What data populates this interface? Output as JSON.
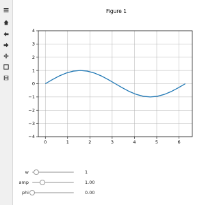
{
  "window": {
    "title": "Figure 1"
  },
  "toolbar": {
    "items": [
      {
        "name": "menu-icon"
      },
      {
        "name": "home-icon"
      },
      {
        "name": "back-arrow-icon"
      },
      {
        "name": "forward-arrow-icon"
      },
      {
        "name": "pan-move-icon"
      },
      {
        "name": "zoom-rect-icon"
      },
      {
        "name": "save-icon"
      }
    ]
  },
  "sliders": [
    {
      "label": "w",
      "value_text": "1",
      "value": 1,
      "min": 0,
      "max": 10
    },
    {
      "label": "amp",
      "value_text": "1.00",
      "value": 1,
      "min": 0,
      "max": 4
    },
    {
      "label": "phi",
      "value_text": "0.00",
      "value": 0,
      "min": 0,
      "max": 6.283
    }
  ],
  "colors": {
    "line": "#1f77b4",
    "grid": "#b0b0b0"
  },
  "chart_data": {
    "type": "line",
    "title": "",
    "xlabel": "",
    "ylabel": "",
    "xlim": [
      -0.314,
      6.597
    ],
    "ylim": [
      -4,
      4
    ],
    "xticks": [
      0,
      1,
      2,
      3,
      4,
      5,
      6
    ],
    "xtick_labels": [
      "0",
      "1",
      "2",
      "3",
      "4",
      "5",
      "6"
    ],
    "yticks": [
      -4,
      -3,
      -2,
      -1,
      0,
      1,
      2,
      3,
      4
    ],
    "ytick_labels": [
      "−4",
      "−3",
      "−2",
      "−1",
      "0",
      "1",
      "2",
      "3",
      "4"
    ],
    "grid": true,
    "series": [
      {
        "x": [
          0,
          0.314,
          0.628,
          0.942,
          1.257,
          1.571,
          1.885,
          2.199,
          2.513,
          2.827,
          3.142,
          3.456,
          3.77,
          4.084,
          4.398,
          4.712,
          5.027,
          5.341,
          5.655,
          5.969,
          6.283
        ],
        "y": [
          0,
          0.309,
          0.588,
          0.809,
          0.951,
          1.0,
          0.951,
          0.809,
          0.588,
          0.309,
          0,
          -0.309,
          -0.588,
          -0.809,
          -0.951,
          -1.0,
          -0.951,
          -0.809,
          -0.588,
          -0.309,
          0
        ]
      }
    ]
  }
}
